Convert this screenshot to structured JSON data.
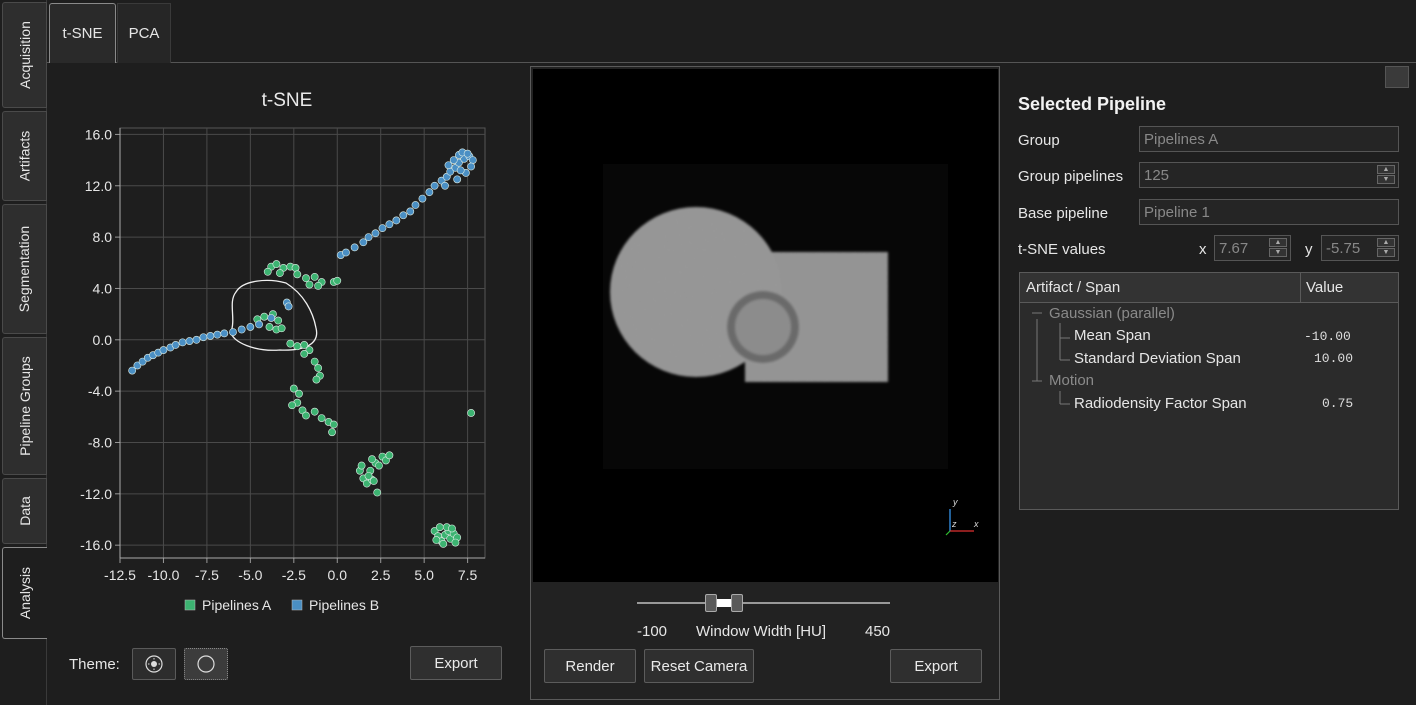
{
  "sidebar": {
    "tabs": [
      {
        "label": "Acquisition"
      },
      {
        "label": "Artifacts"
      },
      {
        "label": "Segmentation"
      },
      {
        "label": "Pipeline Groups"
      },
      {
        "label": "Data"
      },
      {
        "label": "Analysis"
      }
    ]
  },
  "top_tabs": [
    {
      "label": "t-SNE"
    },
    {
      "label": "PCA"
    }
  ],
  "chart_data": {
    "type": "scatter",
    "title": "t-SNE",
    "xlim": [
      -12.5,
      8.5
    ],
    "ylim": [
      -17,
      16.5
    ],
    "xticks": [
      "-12.5",
      "-10.0",
      "-7.5",
      "-5.0",
      "-2.5",
      "0.0",
      "2.5",
      "5.0",
      "7.5"
    ],
    "yticks": [
      "16.0",
      "12.0",
      "8.0",
      "4.0",
      "0.0",
      "-4.0",
      "-8.0",
      "-12.0",
      "-16.0"
    ],
    "grid": true,
    "legend_position": "bottom-center",
    "series": [
      {
        "name": "Pipelines A",
        "color": "#3cb371",
        "points": [
          [
            -3.8,
            5.7
          ],
          [
            -3.5,
            5.9
          ],
          [
            -3.1,
            5.6
          ],
          [
            -2.7,
            5.7
          ],
          [
            -2.4,
            5.6
          ],
          [
            -4.0,
            5.3
          ],
          [
            -3.3,
            5.2
          ],
          [
            -2.3,
            5.1
          ],
          [
            -1.8,
            4.8
          ],
          [
            -1.3,
            4.9
          ],
          [
            -0.9,
            4.5
          ],
          [
            -0.2,
            4.5
          ],
          [
            0.0,
            4.6
          ],
          [
            -1.1,
            4.2
          ],
          [
            -1.6,
            4.3
          ],
          [
            -4.6,
            1.6
          ],
          [
            -4.2,
            1.8
          ],
          [
            -3.7,
            2.0
          ],
          [
            -3.4,
            1.5
          ],
          [
            -3.9,
            1.0
          ],
          [
            -3.5,
            0.8
          ],
          [
            -3.2,
            0.9
          ],
          [
            -2.7,
            -0.3
          ],
          [
            -2.3,
            -0.5
          ],
          [
            -1.9,
            -0.4
          ],
          [
            -1.6,
            -0.8
          ],
          [
            -1.9,
            -1.1
          ],
          [
            -1.3,
            -1.7
          ],
          [
            -1.1,
            -2.2
          ],
          [
            -1.0,
            -2.8
          ],
          [
            -1.2,
            -3.1
          ],
          [
            -2.5,
            -3.8
          ],
          [
            -2.2,
            -4.2
          ],
          [
            -2.3,
            -4.9
          ],
          [
            -2.6,
            -5.1
          ],
          [
            -2.0,
            -5.5
          ],
          [
            -1.8,
            -5.9
          ],
          [
            -1.3,
            -5.6
          ],
          [
            -0.9,
            -6.1
          ],
          [
            -0.5,
            -6.4
          ],
          [
            -0.2,
            -6.6
          ],
          [
            -0.3,
            -7.2
          ],
          [
            1.3,
            -10.2
          ],
          [
            1.5,
            -10.8
          ],
          [
            1.7,
            -11.2
          ],
          [
            2.0,
            -10.9
          ],
          [
            1.9,
            -10.2
          ],
          [
            2.2,
            -9.6
          ],
          [
            2.0,
            -9.3
          ],
          [
            2.4,
            -9.8
          ],
          [
            2.1,
            -11.0
          ],
          [
            1.4,
            -9.8
          ],
          [
            2.3,
            -11.9
          ],
          [
            2.6,
            -9.1
          ],
          [
            2.8,
            -9.4
          ],
          [
            3.0,
            -9.0
          ],
          [
            1.8,
            -10.6
          ],
          [
            5.6,
            -14.9
          ],
          [
            5.8,
            -15.3
          ],
          [
            6.0,
            -15.7
          ],
          [
            6.2,
            -15.2
          ],
          [
            6.4,
            -14.9
          ],
          [
            6.5,
            -15.5
          ],
          [
            6.7,
            -15.1
          ],
          [
            6.9,
            -15.4
          ],
          [
            5.9,
            -14.6
          ],
          [
            6.3,
            -14.6
          ],
          [
            6.6,
            -14.7
          ],
          [
            6.1,
            -15.9
          ],
          [
            5.7,
            -15.6
          ],
          [
            6.8,
            -15.8
          ],
          [
            7.7,
            -5.7
          ]
        ]
      },
      {
        "name": "Pipelines B",
        "color": "#4a8fc4",
        "points": [
          [
            -11.8,
            -2.4
          ],
          [
            -11.5,
            -2.0
          ],
          [
            -11.2,
            -1.7
          ],
          [
            -10.9,
            -1.4
          ],
          [
            -10.6,
            -1.2
          ],
          [
            -10.3,
            -1.0
          ],
          [
            -10.0,
            -0.8
          ],
          [
            -9.6,
            -0.6
          ],
          [
            -9.3,
            -0.4
          ],
          [
            -8.9,
            -0.2
          ],
          [
            -8.5,
            -0.1
          ],
          [
            -8.1,
            0.0
          ],
          [
            -7.7,
            0.2
          ],
          [
            -7.3,
            0.3
          ],
          [
            -6.9,
            0.4
          ],
          [
            -6.5,
            0.5
          ],
          [
            -6.0,
            0.6
          ],
          [
            -5.5,
            0.8
          ],
          [
            -5.0,
            1.0
          ],
          [
            -4.5,
            1.2
          ],
          [
            -3.8,
            1.7
          ],
          [
            -2.9,
            2.9
          ],
          [
            -2.8,
            2.6
          ],
          [
            0.2,
            6.6
          ],
          [
            0.5,
            6.8
          ],
          [
            1.0,
            7.2
          ],
          [
            1.5,
            7.6
          ],
          [
            1.8,
            8.0
          ],
          [
            2.2,
            8.3
          ],
          [
            2.6,
            8.7
          ],
          [
            3.0,
            9.0
          ],
          [
            3.4,
            9.3
          ],
          [
            3.8,
            9.7
          ],
          [
            4.2,
            10.0
          ],
          [
            4.5,
            10.5
          ],
          [
            4.9,
            11.0
          ],
          [
            5.3,
            11.5
          ],
          [
            5.6,
            12.0
          ],
          [
            6.0,
            12.4
          ],
          [
            6.3,
            12.7
          ],
          [
            6.5,
            13.1
          ],
          [
            6.8,
            13.4
          ],
          [
            7.0,
            13.8
          ],
          [
            7.3,
            14.1
          ],
          [
            7.6,
            14.3
          ],
          [
            7.8,
            14.0
          ],
          [
            7.7,
            13.5
          ],
          [
            7.4,
            13.0
          ],
          [
            6.9,
            12.5
          ],
          [
            6.2,
            12.0
          ],
          [
            6.4,
            13.6
          ],
          [
            6.7,
            14.0
          ],
          [
            7.0,
            14.4
          ],
          [
            7.2,
            14.6
          ],
          [
            7.5,
            14.5
          ],
          [
            7.1,
            13.2
          ]
        ]
      }
    ],
    "legend": [
      {
        "label": "Pipelines A"
      },
      {
        "label": "Pipelines B"
      }
    ]
  },
  "theme": {
    "label": "Theme:"
  },
  "chart_export_label": "Export",
  "render": {
    "window_min": "-100",
    "window_label": "Window Width [HU]",
    "window_max": "450",
    "render_label": "Render",
    "reset_camera_label": "Reset Camera",
    "export_label": "Export",
    "axis_y": "y",
    "axis_z": "z",
    "axis_x": "x"
  },
  "selected_pipeline": {
    "title": "Selected Pipeline",
    "group_label": "Group",
    "group_value": "Pipelines A",
    "group_pipelines_label": "Group pipelines",
    "group_pipelines_value": "125",
    "base_pipeline_label": "Base pipeline",
    "base_pipeline_value": "Pipeline 1",
    "tsne_label": "t-SNE values",
    "x_label": "x",
    "x_value": "7.67",
    "y_label": "y",
    "y_value": "-5.75"
  },
  "tree": {
    "col_artifact": "Artifact / Span",
    "col_value": "Value",
    "groups": [
      {
        "name": "Gaussian (parallel)",
        "children": [
          {
            "name": "Mean Span",
            "value": "-10.00"
          },
          {
            "name": "Standard Deviation Span",
            "value": "10.00"
          }
        ]
      },
      {
        "name": "Motion",
        "children": [
          {
            "name": "Radiodensity Factor Span",
            "value": "0.75"
          }
        ]
      }
    ]
  }
}
